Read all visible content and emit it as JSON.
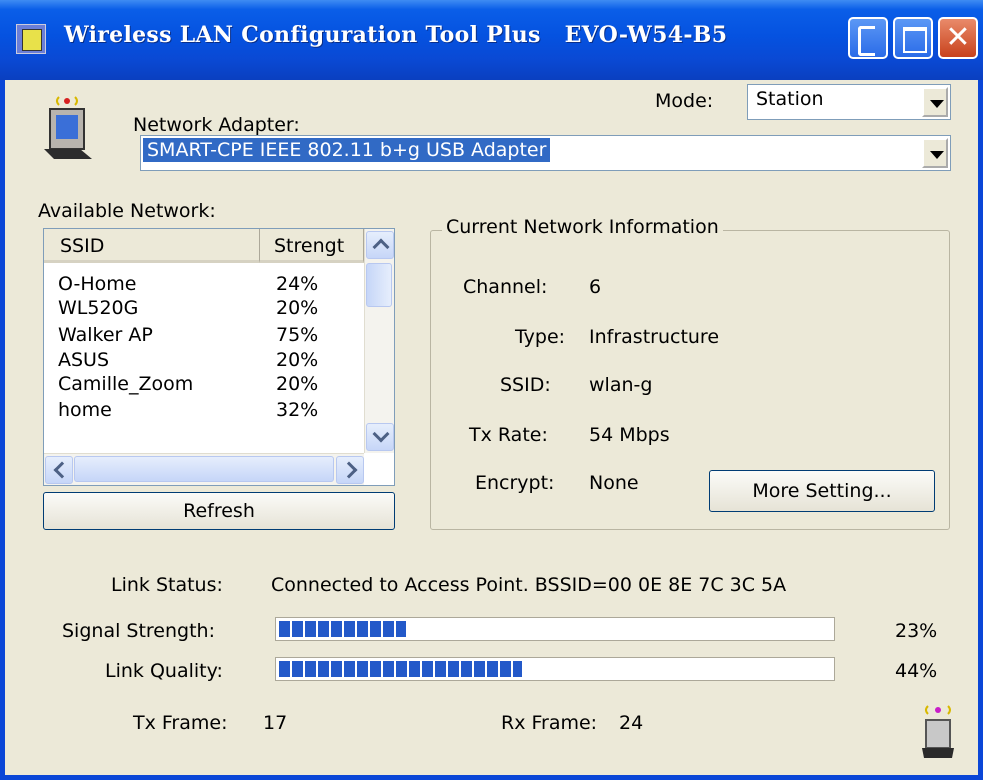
{
  "window": {
    "title": "Wireless LAN Configuration Tool Plus   EVO-W54-B5",
    "close_glyph": "✕"
  },
  "adapter": {
    "label": "Network Adapter:",
    "value": "SMART-CPE IEEE 802.11 b+g USB Adapter"
  },
  "mode": {
    "label": "Mode:",
    "value": "Station"
  },
  "available": {
    "label": "Available Network:",
    "columns": [
      "SSID",
      "Strengt"
    ],
    "rows": [
      {
        "ssid": "O-Home",
        "strength": "24%"
      },
      {
        "ssid": "WL520G",
        "strength": "20%"
      },
      {
        "ssid": "Walker AP",
        "strength": "75%"
      },
      {
        "ssid": "ASUS",
        "strength": "20%"
      },
      {
        "ssid": "Camille_Zoom",
        "strength": "20%"
      },
      {
        "ssid": "home",
        "strength": "32%"
      }
    ],
    "refresh_label": "Refresh"
  },
  "current": {
    "title": "Current Network Information",
    "channel_label": "Channel:",
    "channel_value": "6",
    "type_label": "Type:",
    "type_value": "Infrastructure",
    "ssid_label": "SSID:",
    "ssid_value": "wlan-g",
    "txrate_label": "Tx Rate:",
    "txrate_value": "54 Mbps",
    "encrypt_label": "Encrypt:",
    "encrypt_value": "None",
    "more_label": "More Setting..."
  },
  "status": {
    "link_label": "Link Status:",
    "link_value": "Connected to Access Point. BSSID=00 0E 8E 7C 3C 5A",
    "signal_label": "Signal Strength:",
    "signal_text": "23%",
    "signal_percent": 23,
    "quality_label": "Link Quality:",
    "quality_text": "44%",
    "quality_percent": 44,
    "tx_label": "Tx Frame:",
    "tx_value": "17",
    "rx_label": "Rx Frame:",
    "rx_value": "24"
  },
  "colors": {
    "titlebar": "#0a5ee8",
    "progress": "#2359c9",
    "selection": "#316ac5",
    "window_bg": "#ece9d8"
  }
}
